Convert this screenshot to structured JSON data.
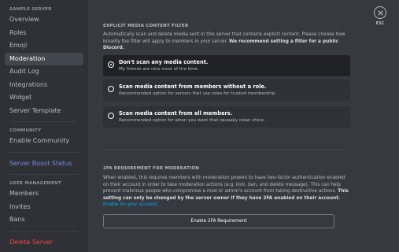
{
  "sidebar": {
    "server_header": "SAMPLE SERVER",
    "server_items": [
      {
        "label": "Overview"
      },
      {
        "label": "Roles"
      },
      {
        "label": "Emoji"
      },
      {
        "label": "Moderation"
      },
      {
        "label": "Audit Log"
      },
      {
        "label": "Integrations"
      },
      {
        "label": "Widget"
      },
      {
        "label": "Server Template"
      }
    ],
    "community_header": "COMMUNITY",
    "enable_community": "Enable Community",
    "boost_status": "Server Boost Status",
    "user_mgmt_header": "USER MANAGEMENT",
    "user_items": [
      {
        "label": "Members"
      },
      {
        "label": "Invites"
      },
      {
        "label": "Bans"
      }
    ],
    "delete_server": "Delete Server"
  },
  "filter": {
    "title": "EXPLICIT MEDIA CONTENT FILTER",
    "description": "Automatically scan and delete media sent in this server that contains explicit content. Please choose how broadly the filter will apply to members in your server.",
    "recommendation": "We recommend setting a filter for a public Discord.",
    "options": [
      {
        "title": "Don't scan any media content.",
        "subtitle": "My friends are nice most of the time.",
        "selected": true
      },
      {
        "title": "Scan media content from members without a role.",
        "subtitle": "Recommended option for servers that use roles for trusted membership.",
        "selected": false
      },
      {
        "title": "Scan media content from all members.",
        "subtitle": "Recommended option for when you want that squeaky clean shine.",
        "selected": false
      }
    ]
  },
  "twofa": {
    "title": "2FA REQUIREMENT FOR MODERATION",
    "description": "When enabled, this requires members with moderation powers to have two-factor authentication enabled on their account in order to take moderation actions (e.g. kick, ban, and delete message). This can help prevent malicious people who compromise a mod or admin's account from taking destructive actions.",
    "bold_note": "This setting can only be changed by the server owner if they have 2FA enabled on their account.",
    "link": "Enable on your account.",
    "button_label": "Enable 2FA Requirement"
  },
  "close": {
    "label": "ESC"
  }
}
